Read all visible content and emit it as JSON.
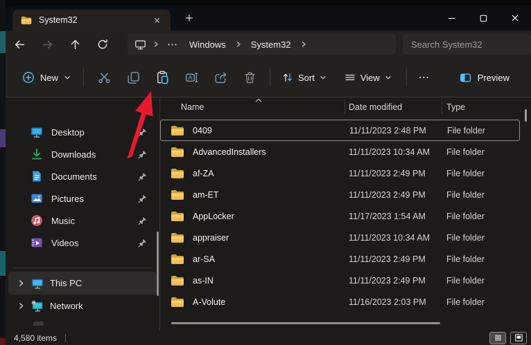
{
  "window": {
    "title": "System32"
  },
  "titlebar": {
    "tab_label": "System32"
  },
  "breadcrumb": {
    "overflow": "⋯",
    "segment1": "Windows",
    "segment2": "System32"
  },
  "search": {
    "placeholder": "Search System32"
  },
  "toolbar": {
    "new_label": "New",
    "sort_label": "Sort",
    "view_label": "View",
    "more_label": "⋯",
    "preview_label": "Preview"
  },
  "sidebar": {
    "items": [
      {
        "label": "Desktop"
      },
      {
        "label": "Downloads"
      },
      {
        "label": "Documents"
      },
      {
        "label": "Pictures"
      },
      {
        "label": "Music"
      },
      {
        "label": "Videos"
      }
    ],
    "tree": [
      {
        "label": "This PC"
      },
      {
        "label": "Network"
      }
    ]
  },
  "files": {
    "columns": [
      "Name",
      "Date modified",
      "Type"
    ],
    "rows": [
      {
        "name": "0409",
        "date": "11/11/2023 2:48 PM",
        "type": "File folder"
      },
      {
        "name": "AdvancedInstallers",
        "date": "11/11/2023 10:34 AM",
        "type": "File folder"
      },
      {
        "name": "af-ZA",
        "date": "11/11/2023 2:49 PM",
        "type": "File folder"
      },
      {
        "name": "am-ET",
        "date": "11/11/2023 2:49 PM",
        "type": "File folder"
      },
      {
        "name": "AppLocker",
        "date": "11/17/2023 1:54 AM",
        "type": "File folder"
      },
      {
        "name": "appraiser",
        "date": "11/11/2023 10:34 AM",
        "type": "File folder"
      },
      {
        "name": "ar-SA",
        "date": "11/11/2023 2:49 PM",
        "type": "File folder"
      },
      {
        "name": "as-IN",
        "date": "11/11/2023 2:49 PM",
        "type": "File folder"
      },
      {
        "name": "A-Volute",
        "date": "11/16/2023 2:03 PM",
        "type": "File folder"
      }
    ]
  },
  "statusbar": {
    "items_count": "4,580 items"
  },
  "annotation": {
    "arrow_color": "#e8192c"
  },
  "colors": {
    "accent_blue": "#4cc2ff",
    "folder_yellow": "#f3c14b",
    "selection_bg": "#2e2c2a"
  }
}
